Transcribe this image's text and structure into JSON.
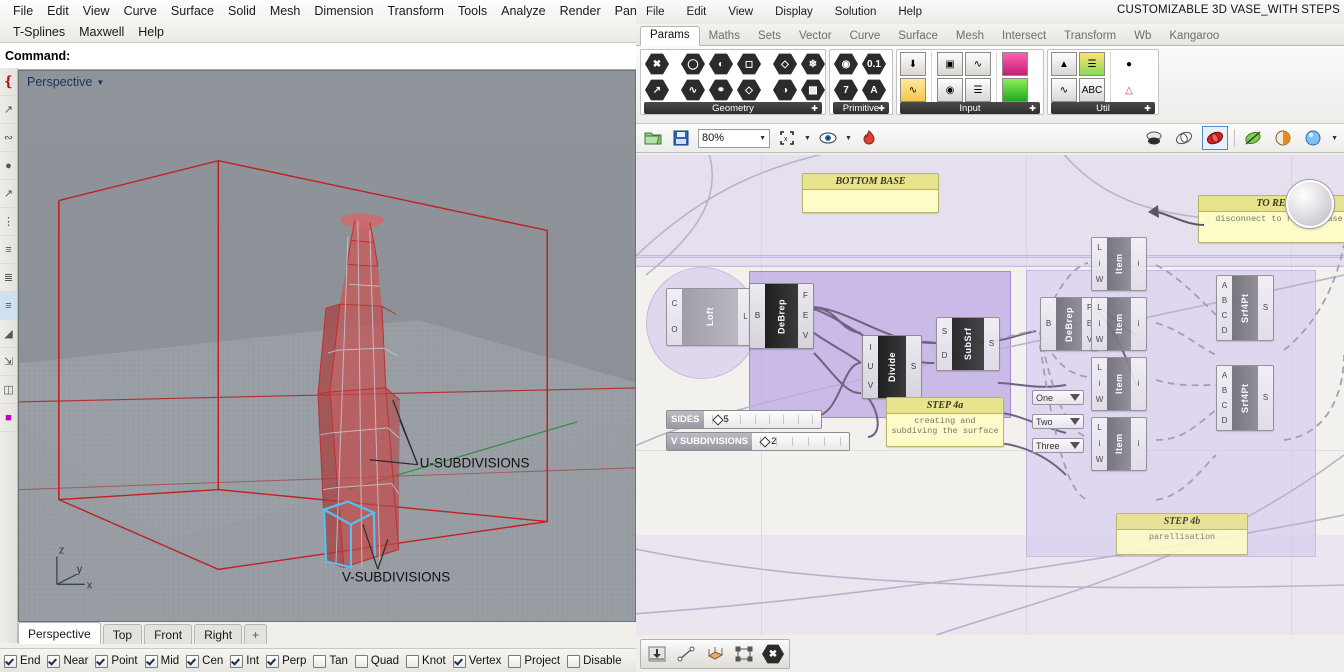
{
  "rhino": {
    "menu_row1": [
      "File",
      "Edit",
      "View",
      "Curve",
      "Surface",
      "Solid",
      "Mesh",
      "Dimension",
      "Transform",
      "Tools",
      "Analyze",
      "Render",
      "Panels"
    ],
    "menu_row2": [
      "T-Splines",
      "Maxwell",
      "Help"
    ],
    "command_label": "Command:",
    "command_value": "",
    "command_placeholder": "",
    "viewport": {
      "title": "Perspective",
      "axis": {
        "z": "z",
        "y": "y",
        "x": "x"
      },
      "annotations": [
        {
          "label": "U-SUBDIVISIONS"
        },
        {
          "label": "V-SUBDIVISIONS"
        }
      ]
    },
    "viewport_tabs": [
      {
        "label": "Perspective",
        "active": true
      },
      {
        "label": "Top",
        "active": false
      },
      {
        "label": "Front",
        "active": false
      },
      {
        "label": "Right",
        "active": false
      },
      {
        "label": "+",
        "active": false
      }
    ],
    "osnaps": [
      {
        "label": "End",
        "checked": true
      },
      {
        "label": "Near",
        "checked": true
      },
      {
        "label": "Point",
        "checked": true
      },
      {
        "label": "Mid",
        "checked": true
      },
      {
        "label": "Cen",
        "checked": true
      },
      {
        "label": "Int",
        "checked": true
      },
      {
        "label": "Perp",
        "checked": true
      },
      {
        "label": "Tan",
        "checked": false
      },
      {
        "label": "Quad",
        "checked": false
      },
      {
        "label": "Knot",
        "checked": false
      },
      {
        "label": "Vertex",
        "checked": true
      },
      {
        "label": "Project",
        "checked": false
      },
      {
        "label": "Disable",
        "checked": false
      }
    ],
    "left_toolbar_icons": [
      "arc-icon",
      "line-icon",
      "curve-icon",
      "point-icon",
      "polyline-icon",
      "extrude-icon",
      "surface-icon",
      "loft-icon",
      "solid-icon",
      "mesh-icon",
      "transform-icon",
      "analyze-icon",
      "render-icon",
      "tsplines-icon"
    ]
  },
  "grasshopper": {
    "menu": [
      "File",
      "Edit",
      "View",
      "Display",
      "Solution",
      "Help"
    ],
    "title": "CUSTOMIZABLE 3D VASE_WITH STEPS",
    "tabs": [
      {
        "label": "Params",
        "active": true
      },
      {
        "label": "Maths",
        "active": false
      },
      {
        "label": "Sets",
        "active": false
      },
      {
        "label": "Vector",
        "active": false
      },
      {
        "label": "Curve",
        "active": false
      },
      {
        "label": "Surface",
        "active": false
      },
      {
        "label": "Mesh",
        "active": false
      },
      {
        "label": "Intersect",
        "active": false
      },
      {
        "label": "Transform",
        "active": false
      },
      {
        "label": "Wb",
        "active": false
      },
      {
        "label": "Kangaroo",
        "active": false
      }
    ],
    "ribbon_groups": [
      {
        "name": "Geometry",
        "icons": [
          "geo-point-icon",
          "geo-curve-icon",
          "geo-circle-icon",
          "geo-arc-icon",
          "geo-surface-icon",
          "geo-brep-icon",
          "geo-mesh-icon",
          "geo-box-icon",
          "geo-field-icon",
          "geo-group-icon"
        ]
      },
      {
        "name": "Primitive",
        "icons": [
          "prim-bool-icon",
          "prim-number-icon",
          "prim-integer-icon",
          "prim-text-icon"
        ]
      },
      {
        "name": "Input",
        "icons": [
          "slider-icon",
          "panel-icon",
          "graph-mapper-icon",
          "gradient-icon",
          "curve-input-icon",
          "button-icon",
          "value-list-icon",
          "colour-swatch-icon"
        ]
      },
      {
        "name": "Util",
        "icons": [
          "tree-icon",
          "gradient-legend-icon",
          "cluster-icon",
          "graph-icon",
          "text-tag-icon",
          "flask-icon"
        ]
      }
    ],
    "toolbar": {
      "open_icon": "open-folder-icon",
      "save_icon": "save-icon",
      "zoom_value": "80%",
      "zoom_extents_icon": "zoom-extents-icon",
      "preview_icon": "eye-preview-icon",
      "bake_icon": "bake-flame-icon",
      "display_modes": [
        {
          "icon": "wireframe-preview-icon",
          "selected": false
        },
        {
          "icon": "shaded-preview-icon",
          "selected": false
        },
        {
          "icon": "render-preview-icon",
          "selected": true
        },
        {
          "icon": "preview-off-icon",
          "selected": false
        },
        {
          "icon": "preview-half-icon",
          "selected": false
        },
        {
          "icon": "preview-full-icon",
          "selected": false
        }
      ]
    },
    "canvas": {
      "panels": [
        {
          "id": "bottom-base",
          "header": "BOTTOM BASE",
          "body": ""
        },
        {
          "id": "to-remove",
          "header": "TO REMO",
          "body": "disconnect to remove base"
        },
        {
          "id": "step-4a",
          "header": "STEP 4a",
          "body": "creating and subdiving the surface"
        },
        {
          "id": "step-4b",
          "header": "STEP 4b",
          "body": "parellisation"
        }
      ],
      "components": [
        {
          "id": "loft",
          "name": "Loft",
          "inputs": [
            "C",
            "O"
          ],
          "outputs": [
            "L"
          ]
        },
        {
          "id": "debrep-1",
          "name": "DeBrep",
          "inputs": [
            "B"
          ],
          "outputs": [
            "F",
            "E",
            "V"
          ]
        },
        {
          "id": "divide",
          "name": "Divide",
          "inputs": [
            "I",
            "U",
            "V"
          ],
          "outputs": [
            "S"
          ]
        },
        {
          "id": "subsrf",
          "name": "SubSrf",
          "inputs": [
            "S",
            "D"
          ],
          "outputs": [
            "S"
          ]
        },
        {
          "id": "debrep-2",
          "name": "DeBrep",
          "inputs": [
            "B"
          ],
          "outputs": [
            "F",
            "E",
            "V"
          ]
        },
        {
          "id": "item-1",
          "name": "Item",
          "inputs": [
            "L",
            "i",
            "W"
          ],
          "outputs": [
            "i"
          ]
        },
        {
          "id": "item-2",
          "name": "Item",
          "inputs": [
            "L",
            "i",
            "W"
          ],
          "outputs": [
            "i"
          ]
        },
        {
          "id": "item-3",
          "name": "Item",
          "inputs": [
            "L",
            "i",
            "W"
          ],
          "outputs": [
            "i"
          ]
        },
        {
          "id": "item-4",
          "name": "Item",
          "inputs": [
            "L",
            "i",
            "W"
          ],
          "outputs": [
            "i"
          ]
        },
        {
          "id": "srf4pt-1",
          "name": "Srf4Pt",
          "inputs": [
            "A",
            "B",
            "C",
            "D"
          ],
          "outputs": [
            "S"
          ]
        },
        {
          "id": "srf4pt-2",
          "name": "Srf4Pt",
          "inputs": [
            "A",
            "B",
            "C",
            "D"
          ],
          "outputs": [
            "S"
          ]
        }
      ],
      "sliders": [
        {
          "id": "sides",
          "label": "SIDES",
          "value": "5"
        },
        {
          "id": "v-subdivisions",
          "label": "V SUBDIVISIONS",
          "value": "2"
        }
      ],
      "dropdowns": [
        {
          "id": "one",
          "label": "One"
        },
        {
          "id": "two",
          "label": "Two"
        },
        {
          "id": "three",
          "label": "Three"
        }
      ]
    },
    "bottom_toolbar_icons": [
      "slider-tool-icon",
      "line-tool-icon",
      "surface-tool-icon",
      "region-tool-icon",
      "clear-tool-icon"
    ]
  }
}
